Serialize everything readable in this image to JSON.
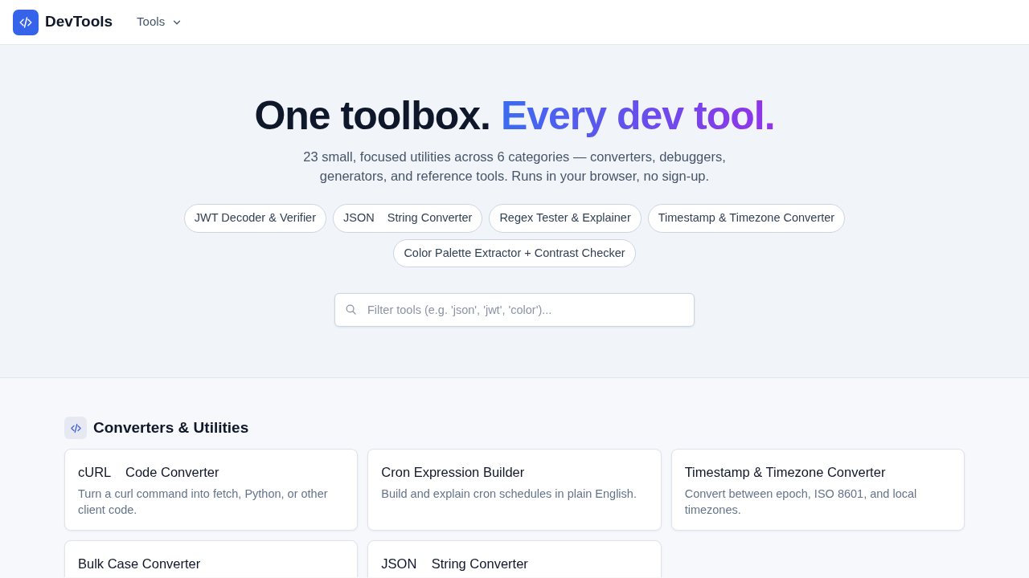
{
  "brand": {
    "name": "DevTools"
  },
  "nav": [
    {
      "label": "Tools",
      "dropdown": true
    }
  ],
  "hero": {
    "title": "One toolbox.",
    "title_accent": "Every dev tool.",
    "subtitle": "23 small, focused utilities across 6 categories — converters, debuggers, generators, and reference tools. Runs in your browser, no sign-up.",
    "chips": [
      "JWT Decoder & Verifier",
      "JSON    String Converter",
      "Regex Tester & Explainer",
      "Timestamp & Timezone Converter",
      "Color Palette Extractor + Contrast Checker"
    ],
    "search": {
      "placeholder": "Filter tools (e.g. 'json', 'jwt', 'color')..."
    }
  },
  "sections": [
    {
      "title": "Converters & Utilities",
      "tools": [
        {
          "name": "cURL    Code Converter",
          "description": "Turn a curl command into fetch, Python, or other client code."
        },
        {
          "name": "Cron Expression Builder",
          "description": "Build and explain cron schedules in plain English."
        },
        {
          "name": "Timestamp & Timezone Converter",
          "description": "Convert between epoch, ISO 8601, and local timezones."
        },
        {
          "name": "Bulk Case Converter"
        },
        {
          "name": "JSON    String Converter"
        }
      ]
    }
  ]
}
